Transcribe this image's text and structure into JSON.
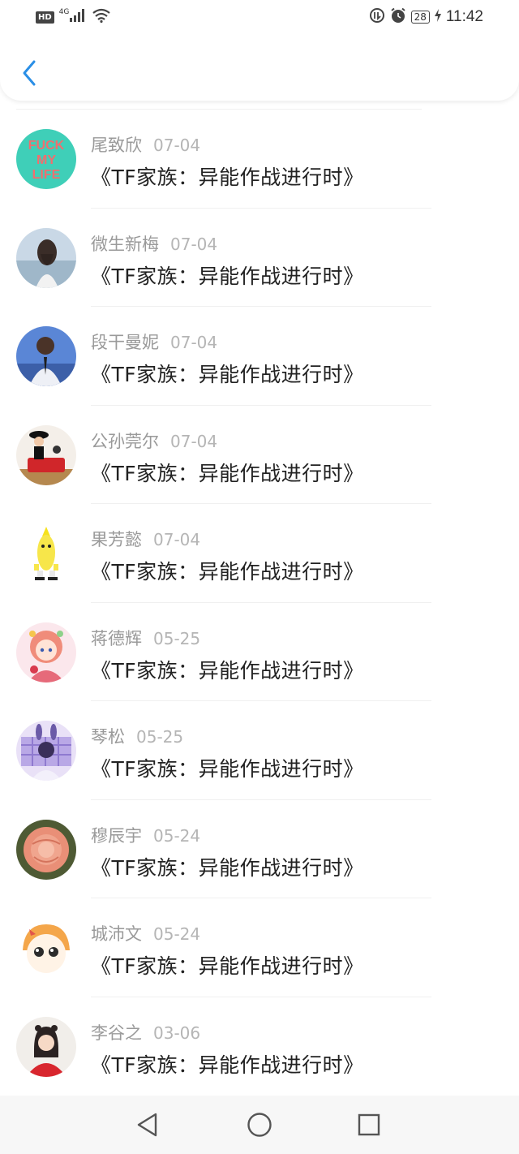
{
  "status_bar": {
    "hd_label": "HD",
    "network_label": "4G",
    "battery": "28",
    "time": "11:42"
  },
  "header": {
    "back_icon": "chevron-left-icon",
    "accent_color": "#2b8fe6"
  },
  "list": {
    "items": [
      {
        "name": "尾致欣",
        "date": "07-04",
        "title": "《TF家族：异能作战进行时》",
        "avatar_text": [
          "FUCK",
          "MY",
          "LIFE"
        ]
      },
      {
        "name": "微生新梅",
        "date": "07-04",
        "title": "《TF家族：异能作战进行时》"
      },
      {
        "name": "段干曼妮",
        "date": "07-04",
        "title": "《TF家族：异能作战进行时》"
      },
      {
        "name": "公孙莞尔",
        "date": "07-04",
        "title": "《TF家族：异能作战进行时》"
      },
      {
        "name": "果芳懿",
        "date": "07-04",
        "title": "《TF家族：异能作战进行时》"
      },
      {
        "name": "蒋德辉",
        "date": "05-25",
        "title": "《TF家族：异能作战进行时》"
      },
      {
        "name": "琴松",
        "date": "05-25",
        "title": "《TF家族：异能作战进行时》"
      },
      {
        "name": "穆辰宇",
        "date": "05-24",
        "title": "《TF家族：异能作战进行时》"
      },
      {
        "name": "城沛文",
        "date": "05-24",
        "title": "《TF家族：异能作战进行时》"
      },
      {
        "name": "李谷之",
        "date": "03-06",
        "title": "《TF家族：异能作战进行时》"
      }
    ]
  },
  "nav_bar": {
    "back": "triangle-back-icon",
    "home": "circle-home-icon",
    "recents": "square-recents-icon"
  }
}
